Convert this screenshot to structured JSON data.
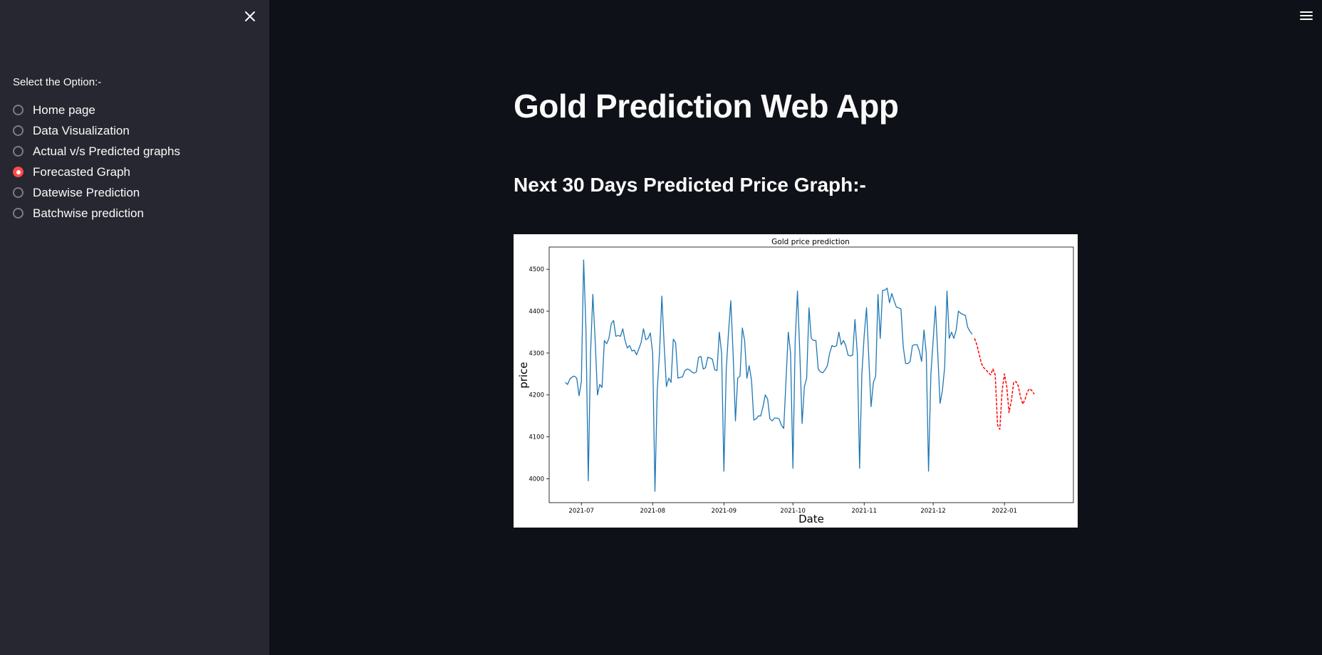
{
  "sidebar": {
    "close_icon": "close-icon",
    "label": "Select the Option:-",
    "options": [
      {
        "label": "Home page",
        "selected": false
      },
      {
        "label": "Data Visualization",
        "selected": false
      },
      {
        "label": "Actual v/s Predicted graphs",
        "selected": false
      },
      {
        "label": "Forecasted Graph",
        "selected": true
      },
      {
        "label": "Datewise Prediction",
        "selected": false
      },
      {
        "label": "Batchwise prediction",
        "selected": false
      }
    ],
    "accent_color": "#ff4b4b"
  },
  "header": {
    "menu_icon": "hamburger-menu-icon"
  },
  "main": {
    "title": "Gold Prediction Web App",
    "subtitle": "Next 30 Days Predicted Price Graph:-"
  },
  "chart_data": {
    "type": "line",
    "title": "Gold price prediction",
    "xlabel": "Date",
    "ylabel": "price",
    "x_ticks": [
      "2021-07",
      "2021-08",
      "2021-09",
      "2021-10",
      "2021-11",
      "2021-12",
      "2022-01"
    ],
    "y_ticks": [
      4000,
      4100,
      4200,
      4300,
      4400,
      4500
    ],
    "ylim": [
      3943,
      4553
    ],
    "xlim": [
      "2021-06-17",
      "2022-01-31"
    ],
    "grid": false,
    "series": [
      {
        "color": "#1f77b4",
        "style": "solid",
        "points": [
          [
            "2021-06-24",
            4230
          ],
          [
            "2021-06-25",
            4225
          ],
          [
            "2021-06-26",
            4238
          ],
          [
            "2021-06-27",
            4243
          ],
          [
            "2021-06-28",
            4245
          ],
          [
            "2021-06-29",
            4240
          ],
          [
            "2021-06-30",
            4198
          ],
          [
            "2021-07-01",
            4232
          ],
          [
            "2021-07-02",
            4522
          ],
          [
            "2021-07-03",
            4360
          ],
          [
            "2021-07-04",
            3995
          ],
          [
            "2021-07-05",
            4300
          ],
          [
            "2021-07-06",
            4440
          ],
          [
            "2021-07-07",
            4330
          ],
          [
            "2021-07-08",
            4200
          ],
          [
            "2021-07-09",
            4225
          ],
          [
            "2021-07-10",
            4218
          ],
          [
            "2021-07-11",
            4330
          ],
          [
            "2021-07-12",
            4322
          ],
          [
            "2021-07-13",
            4335
          ],
          [
            "2021-07-14",
            4370
          ],
          [
            "2021-07-15",
            4378
          ],
          [
            "2021-07-16",
            4340
          ],
          [
            "2021-07-17",
            4342
          ],
          [
            "2021-07-18",
            4340
          ],
          [
            "2021-07-19",
            4358
          ],
          [
            "2021-07-20",
            4330
          ],
          [
            "2021-07-21",
            4312
          ],
          [
            "2021-07-22",
            4318
          ],
          [
            "2021-07-23",
            4305
          ],
          [
            "2021-07-24",
            4307
          ],
          [
            "2021-07-25",
            4296
          ],
          [
            "2021-07-26",
            4310
          ],
          [
            "2021-07-27",
            4325
          ],
          [
            "2021-07-28",
            4358
          ],
          [
            "2021-07-29",
            4332
          ],
          [
            "2021-07-30",
            4335
          ],
          [
            "2021-07-31",
            4348
          ],
          [
            "2021-08-01",
            4300
          ],
          [
            "2021-08-02",
            3970
          ],
          [
            "2021-08-03",
            4210
          ],
          [
            "2021-08-04",
            4300
          ],
          [
            "2021-08-05",
            4436
          ],
          [
            "2021-08-06",
            4320
          ],
          [
            "2021-08-07",
            4220
          ],
          [
            "2021-08-08",
            4240
          ],
          [
            "2021-08-09",
            4230
          ],
          [
            "2021-08-10",
            4333
          ],
          [
            "2021-08-11",
            4325
          ],
          [
            "2021-08-12",
            4240
          ],
          [
            "2021-08-13",
            4242
          ],
          [
            "2021-08-14",
            4243
          ],
          [
            "2021-08-15",
            4258
          ],
          [
            "2021-08-16",
            4262
          ],
          [
            "2021-08-17",
            4260
          ],
          [
            "2021-08-18",
            4255
          ],
          [
            "2021-08-19",
            4252
          ],
          [
            "2021-08-20",
            4255
          ],
          [
            "2021-08-21",
            4290
          ],
          [
            "2021-08-22",
            4292
          ],
          [
            "2021-08-23",
            4262
          ],
          [
            "2021-08-24",
            4265
          ],
          [
            "2021-08-25",
            4290
          ],
          [
            "2021-08-26",
            4288
          ],
          [
            "2021-08-27",
            4285
          ],
          [
            "2021-08-28",
            4260
          ],
          [
            "2021-08-29",
            4258
          ],
          [
            "2021-08-30",
            4350
          ],
          [
            "2021-08-31",
            4300
          ],
          [
            "2021-09-01",
            4018
          ],
          [
            "2021-09-02",
            4260
          ],
          [
            "2021-09-03",
            4350
          ],
          [
            "2021-09-04",
            4425
          ],
          [
            "2021-09-05",
            4300
          ],
          [
            "2021-09-06",
            4138
          ],
          [
            "2021-09-07",
            4240
          ],
          [
            "2021-09-08",
            4245
          ],
          [
            "2021-09-09",
            4360
          ],
          [
            "2021-09-10",
            4330
          ],
          [
            "2021-09-11",
            4240
          ],
          [
            "2021-09-12",
            4270
          ],
          [
            "2021-09-13",
            4235
          ],
          [
            "2021-09-14",
            4140
          ],
          [
            "2021-09-15",
            4143
          ],
          [
            "2021-09-16",
            4150
          ],
          [
            "2021-09-17",
            4150
          ],
          [
            "2021-09-18",
            4172
          ],
          [
            "2021-09-19",
            4200
          ],
          [
            "2021-09-20",
            4190
          ],
          [
            "2021-09-21",
            4143
          ],
          [
            "2021-09-22",
            4138
          ],
          [
            "2021-09-23",
            4145
          ],
          [
            "2021-09-24",
            4145
          ],
          [
            "2021-09-25",
            4143
          ],
          [
            "2021-09-26",
            4128
          ],
          [
            "2021-09-27",
            4120
          ],
          [
            "2021-09-28",
            4235
          ],
          [
            "2021-09-29",
            4350
          ],
          [
            "2021-09-30",
            4300
          ],
          [
            "2021-10-01",
            4025
          ],
          [
            "2021-10-02",
            4330
          ],
          [
            "2021-10-03",
            4448
          ],
          [
            "2021-10-04",
            4300
          ],
          [
            "2021-10-05",
            4132
          ],
          [
            "2021-10-06",
            4220
          ],
          [
            "2021-10-07",
            4240
          ],
          [
            "2021-10-08",
            4408
          ],
          [
            "2021-10-09",
            4335
          ],
          [
            "2021-10-10",
            4330
          ],
          [
            "2021-10-11",
            4330
          ],
          [
            "2021-10-12",
            4262
          ],
          [
            "2021-10-13",
            4255
          ],
          [
            "2021-10-14",
            4253
          ],
          [
            "2021-10-15",
            4260
          ],
          [
            "2021-10-16",
            4270
          ],
          [
            "2021-10-17",
            4300
          ],
          [
            "2021-10-18",
            4318
          ],
          [
            "2021-10-19",
            4315
          ],
          [
            "2021-10-20",
            4318
          ],
          [
            "2021-10-21",
            4350
          ],
          [
            "2021-10-22",
            4320
          ],
          [
            "2021-10-23",
            4330
          ],
          [
            "2021-10-24",
            4318
          ],
          [
            "2021-10-25",
            4295
          ],
          [
            "2021-10-26",
            4293
          ],
          [
            "2021-10-27",
            4295
          ],
          [
            "2021-10-28",
            4380
          ],
          [
            "2021-10-29",
            4300
          ],
          [
            "2021-10-30",
            4025
          ],
          [
            "2021-10-31",
            4250
          ],
          [
            "2021-11-01",
            4340
          ],
          [
            "2021-11-02",
            4408
          ],
          [
            "2021-11-03",
            4290
          ],
          [
            "2021-11-04",
            4172
          ],
          [
            "2021-11-05",
            4230
          ],
          [
            "2021-11-06",
            4245
          ],
          [
            "2021-11-07",
            4440
          ],
          [
            "2021-11-08",
            4335
          ],
          [
            "2021-11-09",
            4450
          ],
          [
            "2021-11-10",
            4450
          ],
          [
            "2021-11-11",
            4455
          ],
          [
            "2021-11-12",
            4420
          ],
          [
            "2021-11-13",
            4442
          ],
          [
            "2021-11-14",
            4425
          ],
          [
            "2021-11-15",
            4410
          ],
          [
            "2021-11-16",
            4408
          ],
          [
            "2021-11-17",
            4405
          ],
          [
            "2021-11-18",
            4315
          ],
          [
            "2021-11-19",
            4275
          ],
          [
            "2021-11-20",
            4275
          ],
          [
            "2021-11-21",
            4280
          ],
          [
            "2021-11-22",
            4318
          ],
          [
            "2021-11-23",
            4320
          ],
          [
            "2021-11-24",
            4320
          ],
          [
            "2021-11-25",
            4305
          ],
          [
            "2021-11-26",
            4280
          ],
          [
            "2021-11-27",
            4355
          ],
          [
            "2021-11-28",
            4300
          ],
          [
            "2021-11-29",
            4018
          ],
          [
            "2021-11-30",
            4250
          ],
          [
            "2021-12-01",
            4330
          ],
          [
            "2021-12-02",
            4412
          ],
          [
            "2021-12-03",
            4300
          ],
          [
            "2021-12-04",
            4180
          ],
          [
            "2021-12-05",
            4210
          ],
          [
            "2021-12-06",
            4265
          ],
          [
            "2021-12-07",
            4448
          ],
          [
            "2021-12-08",
            4335
          ],
          [
            "2021-12-09",
            4350
          ],
          [
            "2021-12-10",
            4335
          ],
          [
            "2021-12-11",
            4355
          ],
          [
            "2021-12-12",
            4400
          ],
          [
            "2021-12-13",
            4395
          ],
          [
            "2021-12-14",
            4392
          ],
          [
            "2021-12-15",
            4390
          ],
          [
            "2021-12-16",
            4362
          ],
          [
            "2021-12-17",
            4352
          ],
          [
            "2021-12-18",
            4345
          ]
        ]
      },
      {
        "color": "#ff0000",
        "style": "dashed",
        "points": [
          [
            "2021-12-19",
            4335
          ],
          [
            "2021-12-20",
            4320
          ],
          [
            "2021-12-21",
            4298
          ],
          [
            "2021-12-22",
            4275
          ],
          [
            "2021-12-23",
            4265
          ],
          [
            "2021-12-24",
            4260
          ],
          [
            "2021-12-25",
            4253
          ],
          [
            "2021-12-26",
            4248
          ],
          [
            "2021-12-27",
            4262
          ],
          [
            "2021-12-28",
            4248
          ],
          [
            "2021-12-29",
            4128
          ],
          [
            "2021-12-30",
            4118
          ],
          [
            "2021-12-31",
            4210
          ],
          [
            "2022-01-01",
            4250
          ],
          [
            "2022-01-02",
            4220
          ],
          [
            "2022-01-03",
            4158
          ],
          [
            "2022-01-04",
            4185
          ],
          [
            "2022-01-05",
            4230
          ],
          [
            "2022-01-06",
            4232
          ],
          [
            "2022-01-07",
            4222
          ],
          [
            "2022-01-08",
            4195
          ],
          [
            "2022-01-09",
            4178
          ],
          [
            "2022-01-10",
            4190
          ],
          [
            "2022-01-11",
            4208
          ],
          [
            "2022-01-12",
            4215
          ],
          [
            "2022-01-13",
            4210
          ],
          [
            "2022-01-14",
            4202
          ]
        ]
      }
    ]
  }
}
